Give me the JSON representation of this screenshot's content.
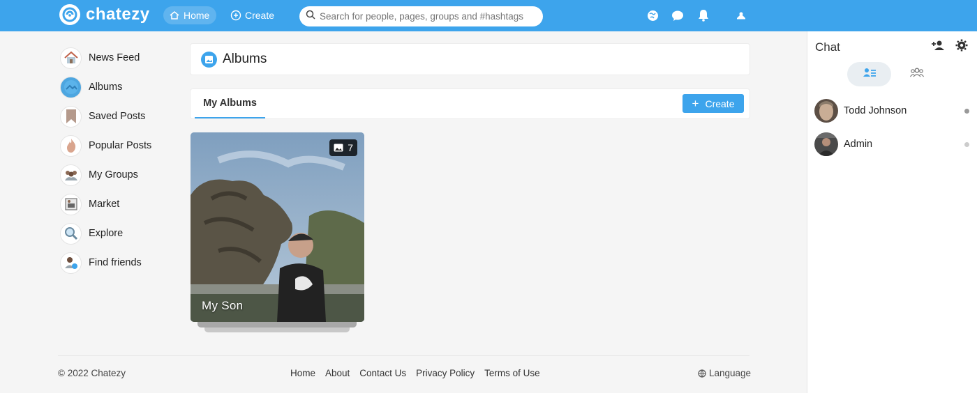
{
  "app": {
    "name": "chatezy",
    "brand_color": "#3da4ec"
  },
  "topbar": {
    "home_label": "Home",
    "create_label": "Create",
    "search_placeholder": "Search for people, pages, groups and #hashtags",
    "icons": [
      "globe-icon",
      "chat-bubble-icon",
      "bell-icon",
      "profile-avatar-icon"
    ]
  },
  "sidebar": {
    "items": [
      {
        "label": "News Feed",
        "icon": "house-icon"
      },
      {
        "label": "Albums",
        "icon": "albums-icon"
      },
      {
        "label": "Saved Posts",
        "icon": "bookmark-icon"
      },
      {
        "label": "Popular Posts",
        "icon": "fire-icon"
      },
      {
        "label": "My Groups",
        "icon": "group-icon"
      },
      {
        "label": "Market",
        "icon": "market-icon"
      },
      {
        "label": "Explore",
        "icon": "magnifier-icon"
      },
      {
        "label": "Find friends",
        "icon": "find-friends-icon"
      }
    ]
  },
  "main": {
    "title": "Albums",
    "tab_label": "My Albums",
    "create_label": "Create",
    "albums": [
      {
        "title": "My Son",
        "photo_count": "7"
      }
    ]
  },
  "footer": {
    "copyright": "© 2022 Chatezy",
    "links": [
      "Home",
      "About",
      "Contact Us",
      "Privacy Policy",
      "Terms of Use"
    ],
    "language_label": "Language"
  },
  "chat": {
    "title": "Chat",
    "contacts": [
      {
        "name": "Todd Johnson",
        "status_color": "#999999"
      },
      {
        "name": "Admin",
        "status_color": "#cccccc"
      }
    ]
  }
}
